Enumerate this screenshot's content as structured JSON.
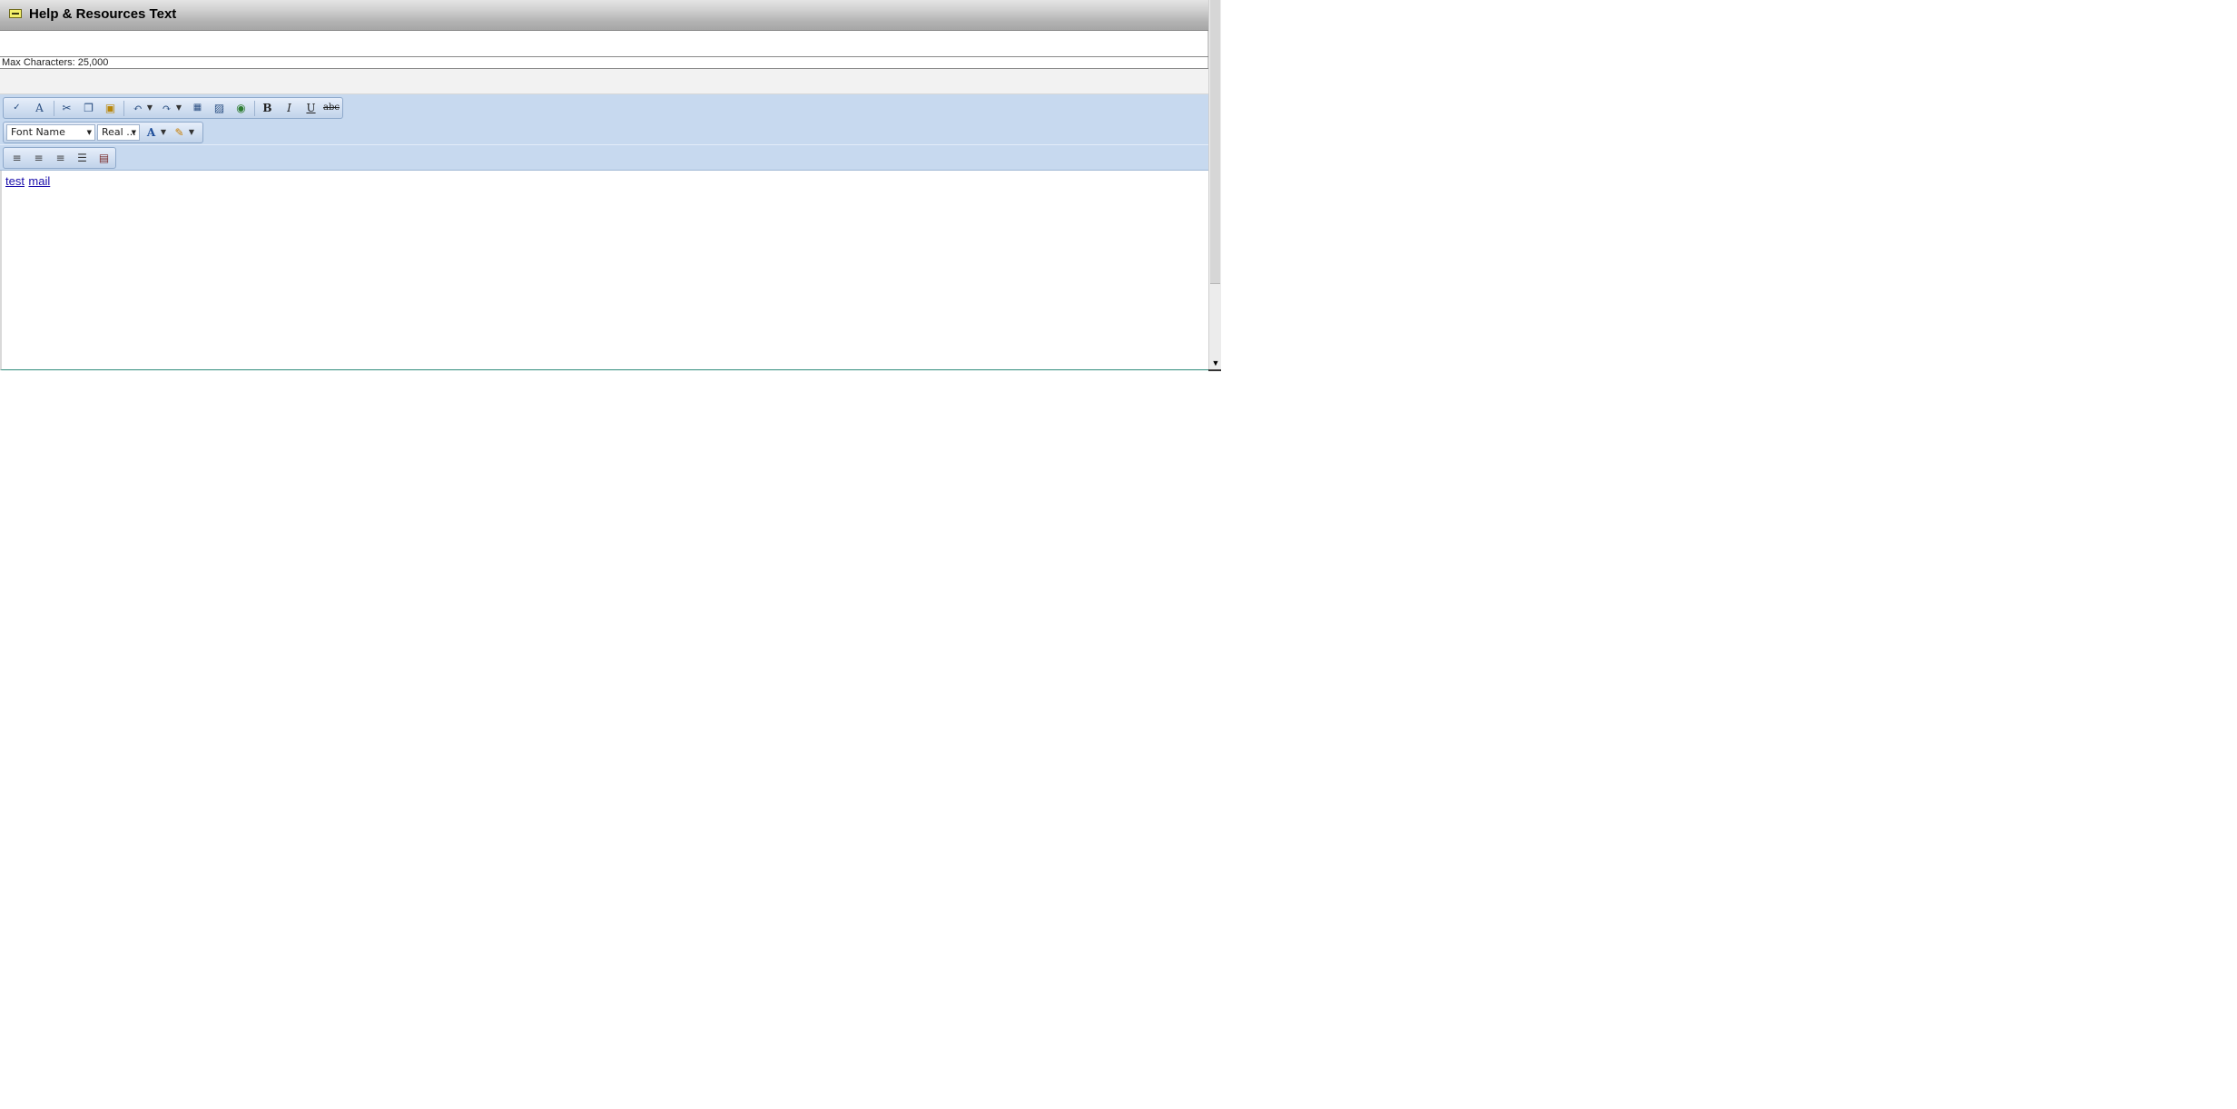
{
  "panel": {
    "title": "Help & Resources Text",
    "max_characters_label": "Max Characters: 25,000"
  },
  "toolbar": {
    "row1": [
      "spellcheck-icon",
      "find-replace-icon",
      "cut-icon",
      "copy-icon",
      "paste-icon",
      "undo-icon",
      "redo-icon",
      "insert-table-icon",
      "image-manager-icon",
      "hyperlink-icon"
    ],
    "bold": "B",
    "italic": "I",
    "underline": "U",
    "strikethrough": "abc",
    "font_name": "Font Name",
    "font_size": "Real ..."
  },
  "editor": {
    "links": [
      "test",
      "mail"
    ]
  }
}
